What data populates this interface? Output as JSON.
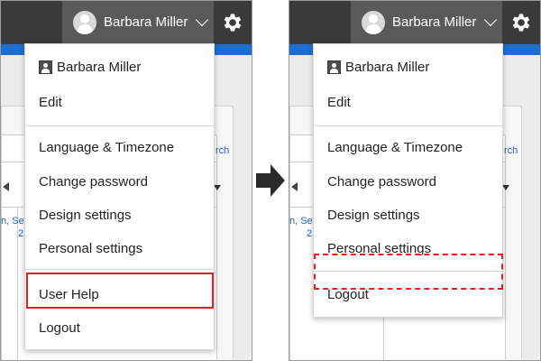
{
  "user": {
    "name": "Barbara Miller"
  },
  "menu": {
    "profile_name": "Barbara Miller",
    "edit": "Edit",
    "language_timezone": "Language & Timezone",
    "change_password": "Change password",
    "design_settings": "Design settings",
    "personal_settings": "Personal settings",
    "user_help": "User Help",
    "logout": "Logout"
  },
  "background": {
    "fragment_rch": "rch",
    "fragment_se": "n, Se",
    "fragment_2": "2"
  },
  "colors": {
    "topbar": "#3a3a3a",
    "user_button": "#5a5a5a",
    "accent_blue": "#1c6fd1",
    "highlight_red": "#e02020",
    "arrow": "#2b2b2b"
  },
  "icons": {
    "avatar": "user-avatar-icon",
    "chevron": "chevron-down-icon",
    "settings": "gear-icon",
    "profile": "user-icon",
    "transition_arrow": "arrow-right-icon"
  }
}
